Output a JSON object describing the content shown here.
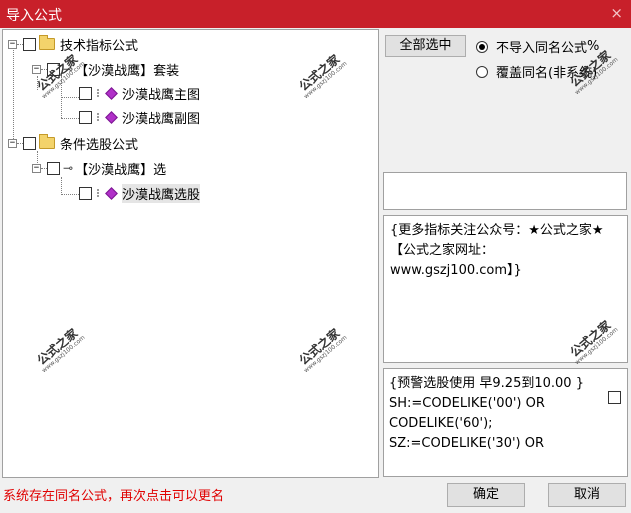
{
  "window": {
    "title": "导入公式",
    "close_glyph": "×"
  },
  "tree": {
    "items": [
      {
        "label": "技术指标公式"
      },
      {
        "label": "【沙漠战鹰】套装"
      },
      {
        "label": "沙漠战鹰主图"
      },
      {
        "label": "沙漠战鹰副图"
      },
      {
        "label": "条件选股公式"
      },
      {
        "label": "【沙漠战鹰】选"
      },
      {
        "label": "沙漠战鹰选股"
      }
    ]
  },
  "options": {
    "select_all": "全部选中",
    "radio_skip": "不导入同名公式",
    "radio_skip_suffix": "%",
    "radio_overwrite": "覆盖同名(非系统)",
    "selected_radio": "skip"
  },
  "info": {
    "text": "{更多指标关注公众号：★公式之家★ 【公式之家网址：www.gszj100.com】}"
  },
  "code": {
    "lines": [
      "{预警选股使用 早9.25到10.00 }",
      "SH:=CODELIKE('00') OR",
      "CODELIKE('60');",
      "SZ:=CODELIKE('30') OR"
    ]
  },
  "watermark": {
    "main": "公式之家",
    "url": "www.gszj100.com"
  },
  "status": "系统存在同名公式，再次点击可以更名",
  "buttons": {
    "ok": "确定",
    "cancel": "取消"
  },
  "colors": {
    "titlebar": "#c8202a",
    "status": "#e00000"
  }
}
